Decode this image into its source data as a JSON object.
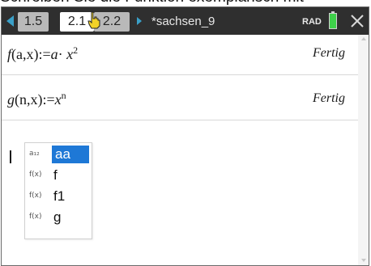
{
  "caption_top": "Schreiben Sie die Funktion exemplarisch mit",
  "toolbar": {
    "tabs": [
      {
        "label": "1.5"
      },
      {
        "label": "2.1"
      },
      {
        "label": "2.2"
      }
    ],
    "document_title": "*sachsen_9",
    "angle_mode": "RAD",
    "battery_color": "#3ed04a",
    "accent_color": "#3aa0c8"
  },
  "calculator": {
    "entries": [
      {
        "lhs_name": "f",
        "lhs_args": "(a,x)",
        "assign": ":=",
        "rhs_coef": "a",
        "rhs_dot": "·",
        "rhs_var": "x",
        "rhs_exp": "2",
        "result": "Fertig"
      },
      {
        "lhs_name": "g",
        "lhs_args": "(n,x)",
        "assign": ":=",
        "rhs_var": "x",
        "rhs_exp": "n",
        "result": "Fertig"
      }
    ]
  },
  "autocomplete": {
    "items": [
      {
        "icon": "variable-icon",
        "icon_text": "a₁₂",
        "label": "aa",
        "selected": true
      },
      {
        "icon": "function-icon",
        "icon_text": "f(x)",
        "label": "f",
        "selected": false
      },
      {
        "icon": "function-icon",
        "icon_text": "f(x)",
        "label": "f1",
        "selected": false
      },
      {
        "icon": "function-icon",
        "icon_text": "f(x)",
        "label": "g",
        "selected": false
      }
    ],
    "highlight_color": "#1e78d6"
  }
}
